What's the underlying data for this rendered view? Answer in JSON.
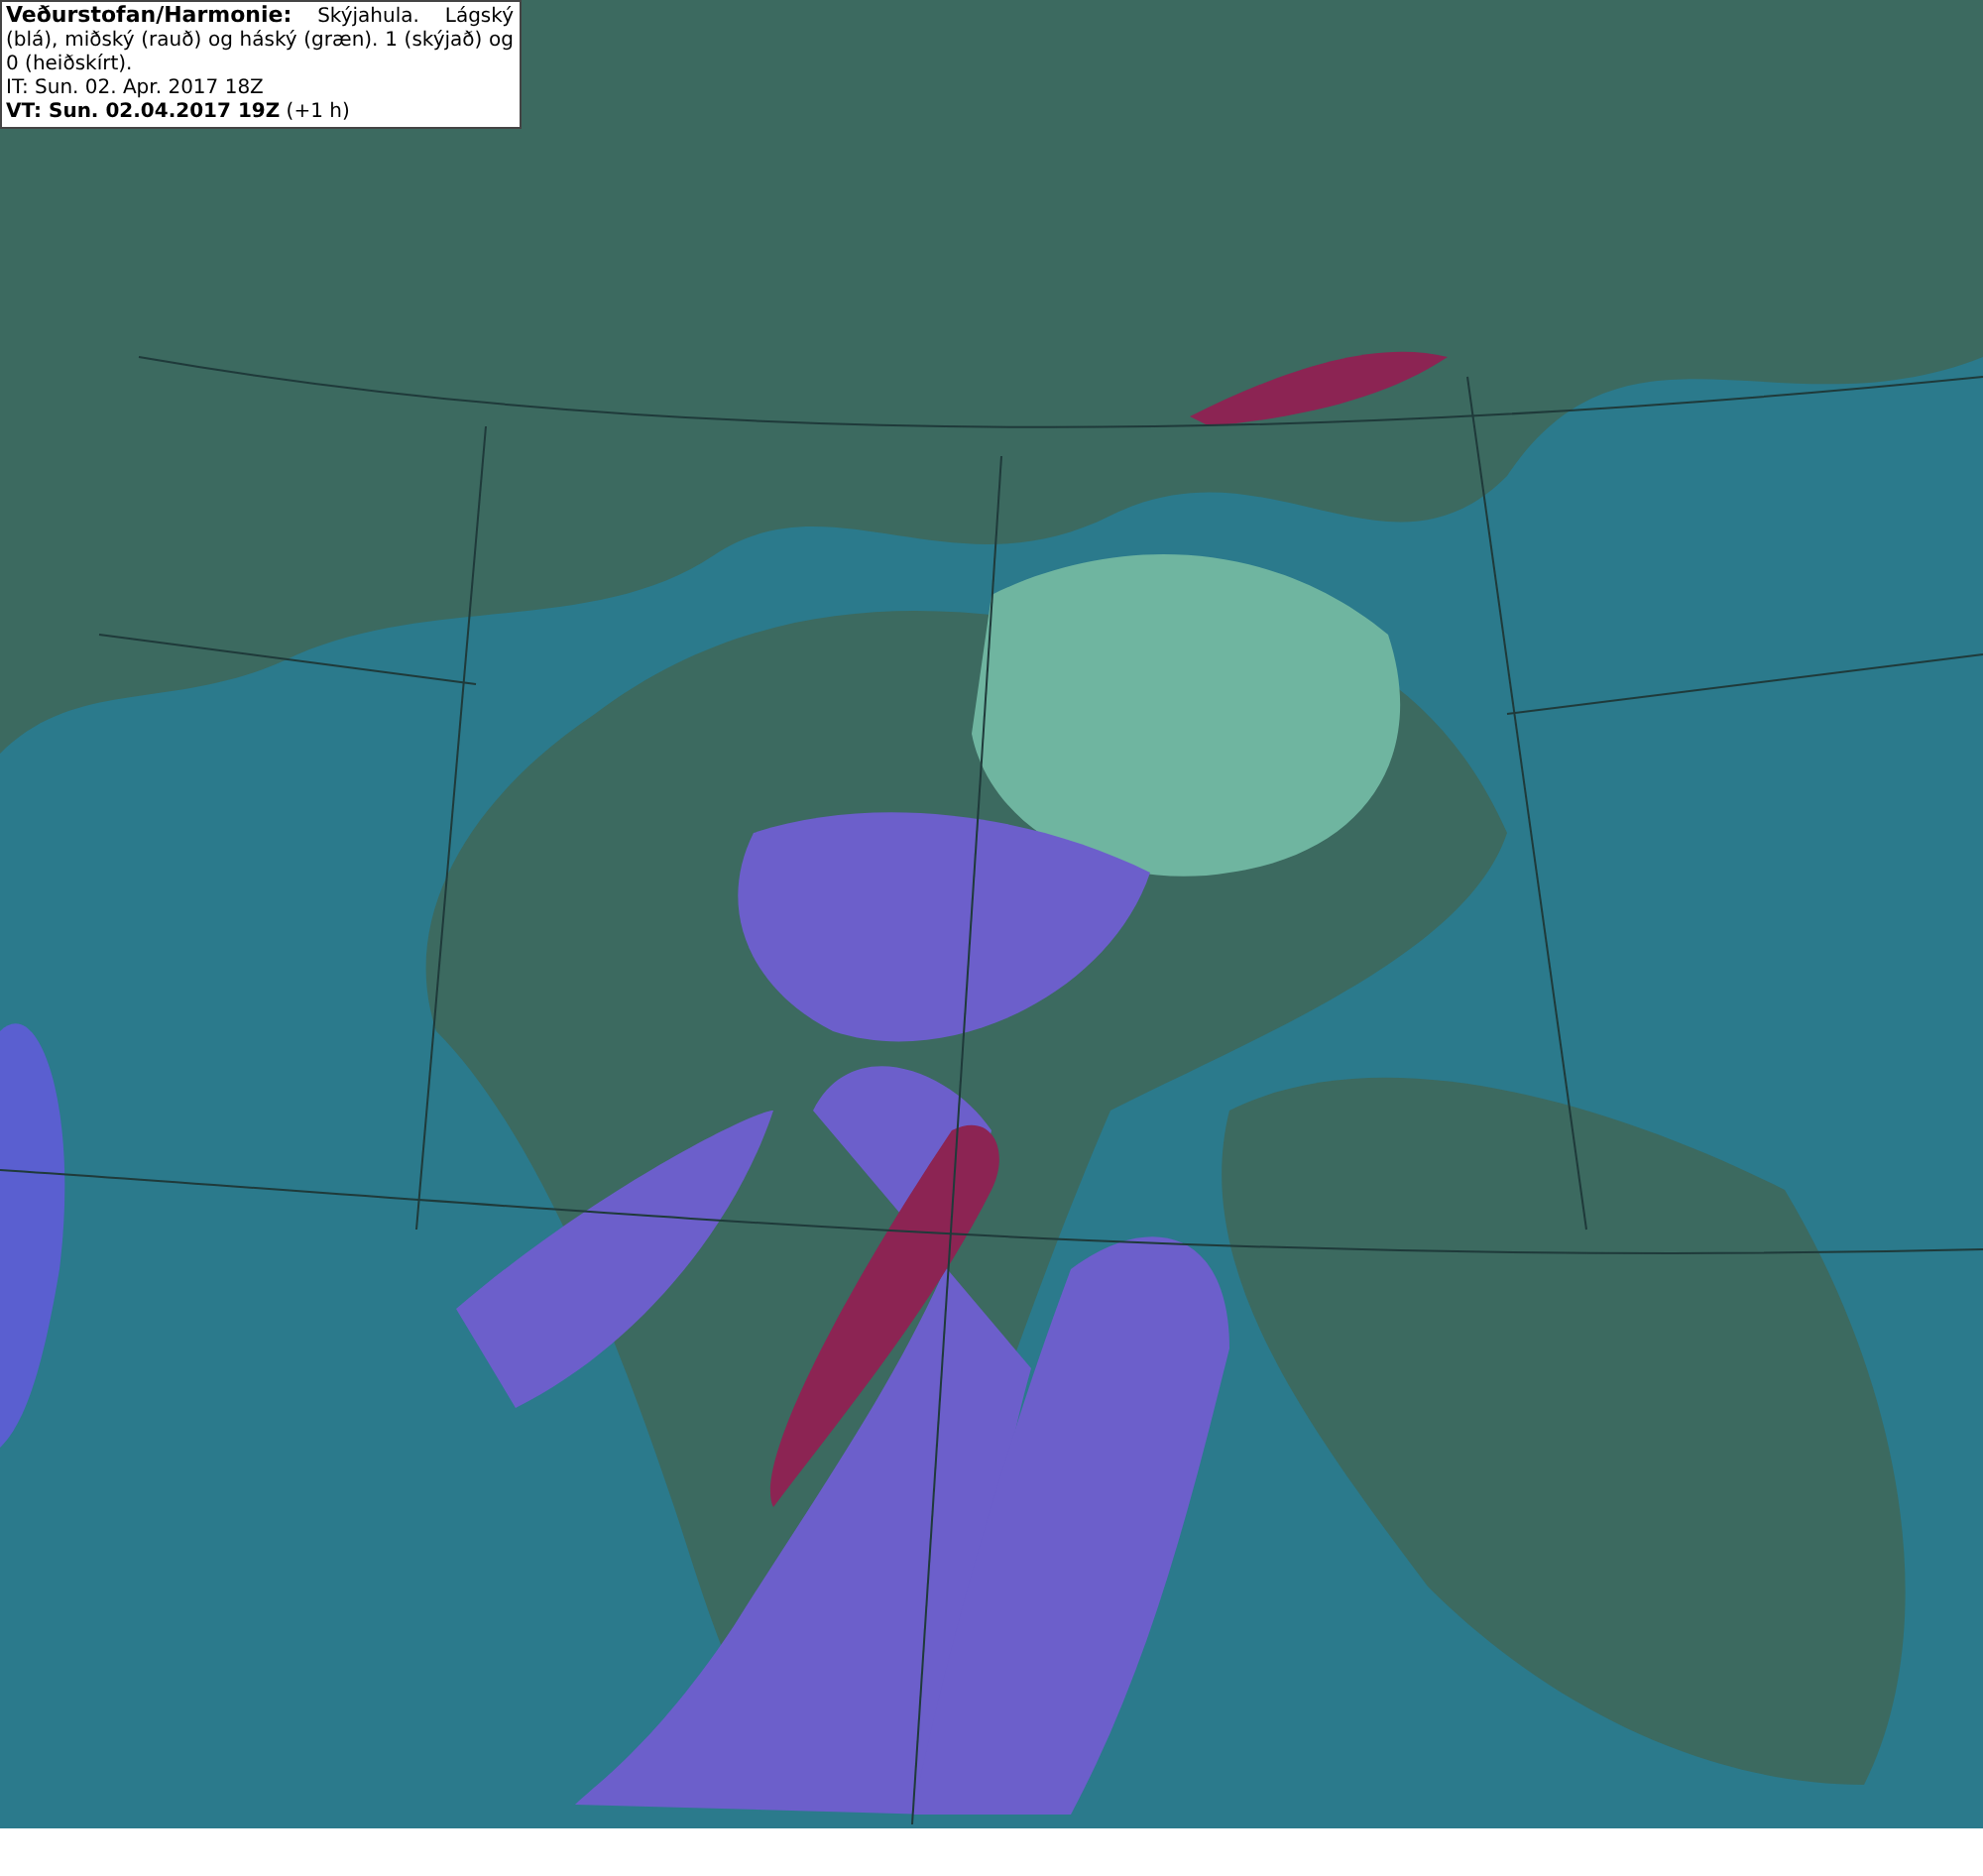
{
  "map": {
    "description": "**Veðurstofan/Harmonie:** Skýjahula. Lágský (blá), miðský (rauð) og háský (græn). 1 (skýjað) og 0 (heiðskírt).",
    "initial_time": "IT: Sun. 02. Apr. 2017 18Z",
    "valid_time": "**VT: Sun. 02.04.2017 19Z** (+1 h)"
  }
}
